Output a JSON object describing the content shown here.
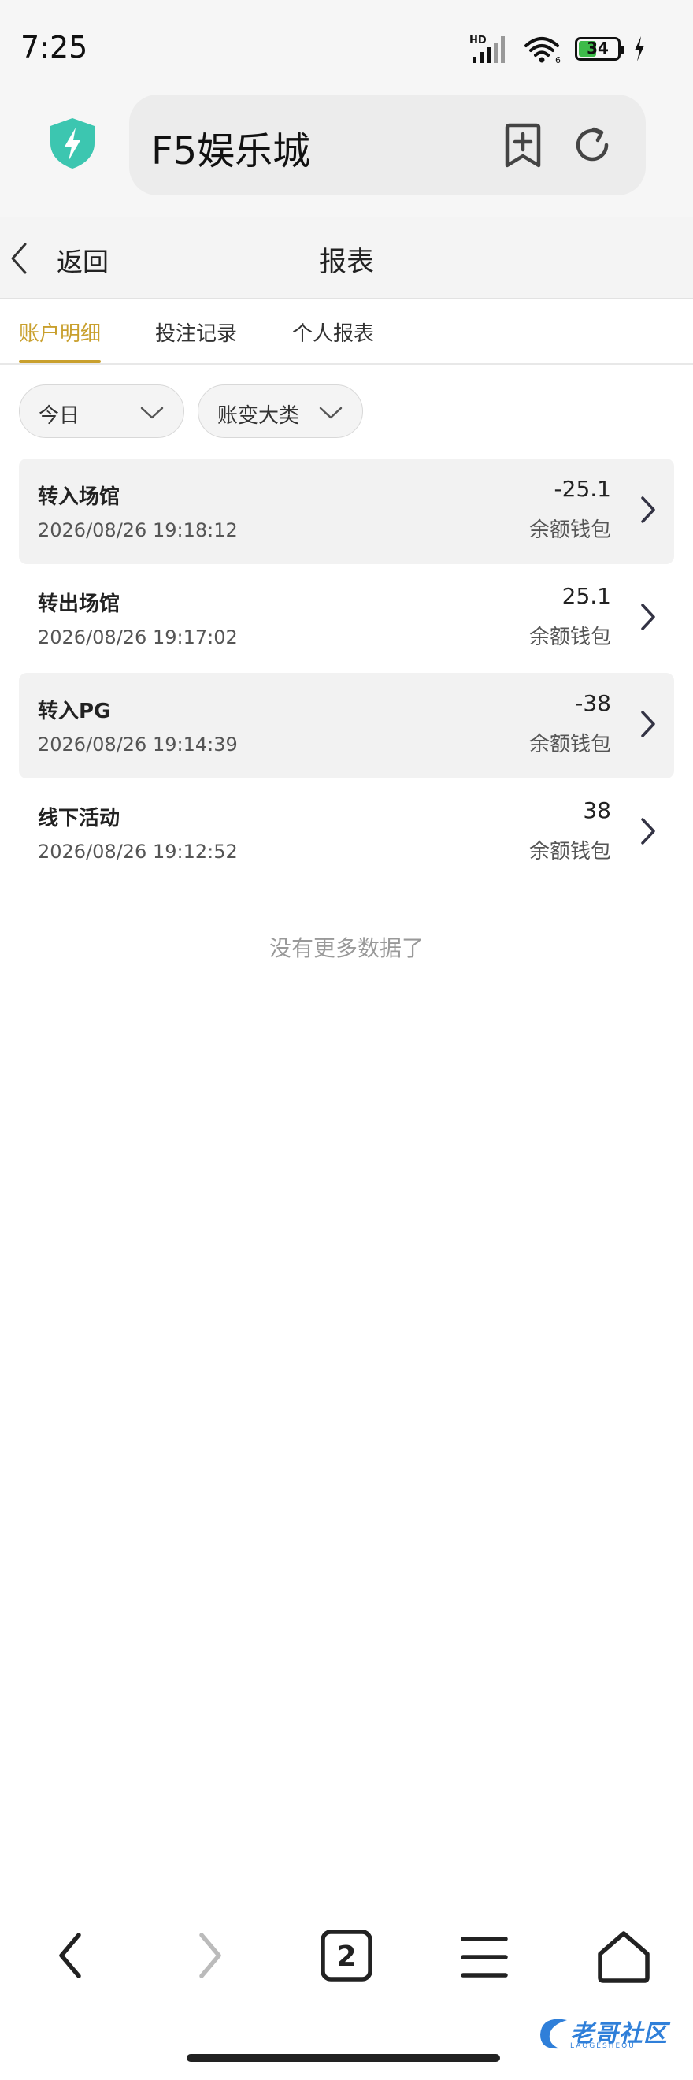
{
  "status_bar": {
    "time": "7:25",
    "network": "HD",
    "battery": "34"
  },
  "browser": {
    "url_text": "F5娱乐城",
    "tab_count": "2"
  },
  "header": {
    "back_label": "返回",
    "title": "报表"
  },
  "tabs": [
    {
      "label": "账户明细",
      "active": true
    },
    {
      "label": "投注记录",
      "active": false
    },
    {
      "label": "个人报表",
      "active": false
    }
  ],
  "filters": {
    "date": "今日",
    "category": "账变大类"
  },
  "records": [
    {
      "title": "转入场馆",
      "date": "2026/08/26 19:18:12",
      "amount": "-25.1",
      "wallet": "余额钱包"
    },
    {
      "title": "转出场馆",
      "date": "2026/08/26 19:17:02",
      "amount": "25.1",
      "wallet": "余额钱包"
    },
    {
      "title": "转入PG",
      "date": "2026/08/26 19:14:39",
      "amount": "-38",
      "wallet": "余额钱包"
    },
    {
      "title": "线下活动",
      "date": "2026/08/26 19:12:52",
      "amount": "38",
      "wallet": "余额钱包"
    }
  ],
  "no_more_text": "没有更多数据了",
  "watermark": {
    "text": "老哥社区",
    "subtext": "LAOGESHEQU"
  },
  "colors": {
    "accent": "#c9a02e",
    "shield": "#3cc6b0",
    "watermark": "#2f7fd9"
  }
}
